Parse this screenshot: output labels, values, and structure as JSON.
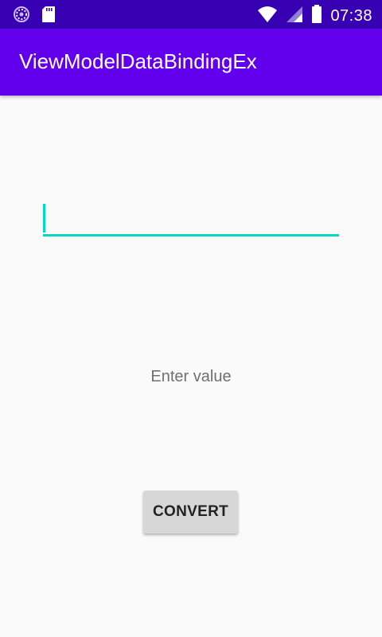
{
  "status_bar": {
    "time": "07:38",
    "background": "#3700b3",
    "icons": [
      "loading-icon",
      "sd-card-icon",
      "wifi-icon",
      "cell-signal-icon",
      "battery-icon"
    ]
  },
  "app_bar": {
    "title": "ViewModelDataBindingEx",
    "background": "#6200ee"
  },
  "form": {
    "input_value": "",
    "accent_color": "#03dac5",
    "label": "Enter value",
    "button_label": "CONVERT"
  }
}
